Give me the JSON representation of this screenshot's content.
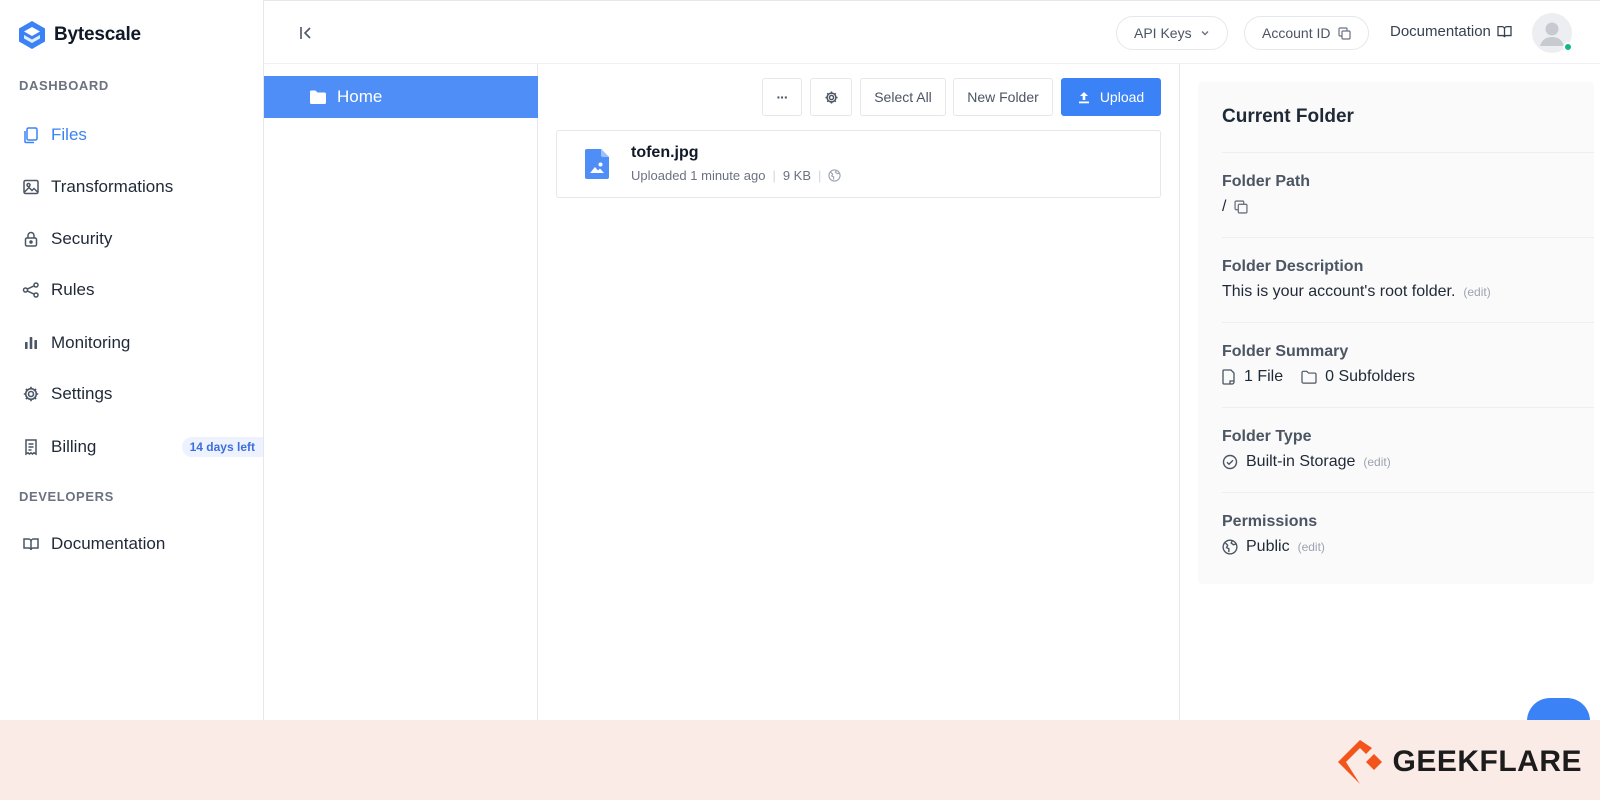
{
  "brand": {
    "name": "Bytescale"
  },
  "sidebar": {
    "sections": [
      {
        "label": "DASHBOARD"
      },
      {
        "label": "DEVELOPERS"
      }
    ],
    "items": [
      {
        "label": "Files",
        "icon": "files-icon",
        "active": true
      },
      {
        "label": "Transformations",
        "icon": "image-icon"
      },
      {
        "label": "Security",
        "icon": "lock-icon"
      },
      {
        "label": "Rules",
        "icon": "share-icon"
      },
      {
        "label": "Monitoring",
        "icon": "bar-chart-icon"
      },
      {
        "label": "Settings",
        "icon": "gear-icon"
      },
      {
        "label": "Billing",
        "icon": "receipt-icon",
        "badge": "14 days left"
      },
      {
        "label": "Documentation",
        "icon": "book-icon"
      }
    ]
  },
  "topbar": {
    "api_keys": "API Keys",
    "account_id": "Account ID",
    "documentation": "Documentation"
  },
  "tree": {
    "root": "Home"
  },
  "toolbar": {
    "more": "···",
    "select_all": "Select All",
    "new_folder": "New Folder",
    "upload": "Upload"
  },
  "files": [
    {
      "name": "tofen.jpg",
      "uploaded": "Uploaded 1 minute ago",
      "size": "9 KB"
    }
  ],
  "panel": {
    "title": "Current Folder",
    "path_label": "Folder Path",
    "path_value": "/",
    "description_label": "Folder Description",
    "description_value": "This is your account's root folder.",
    "summary_label": "Folder Summary",
    "summary_files": "1 File",
    "summary_subfolders": "0 Subfolders",
    "type_label": "Folder Type",
    "type_value": "Built-in Storage",
    "permissions_label": "Permissions",
    "permissions_value": "Public",
    "edit": "(edit)"
  },
  "footer": {
    "watermark": "GEEKFLARE"
  },
  "colors": {
    "accent": "#3b82f6",
    "tree_active": "#4f8ef7",
    "footer_bg": "#fbebe7",
    "online": "#10b981"
  }
}
